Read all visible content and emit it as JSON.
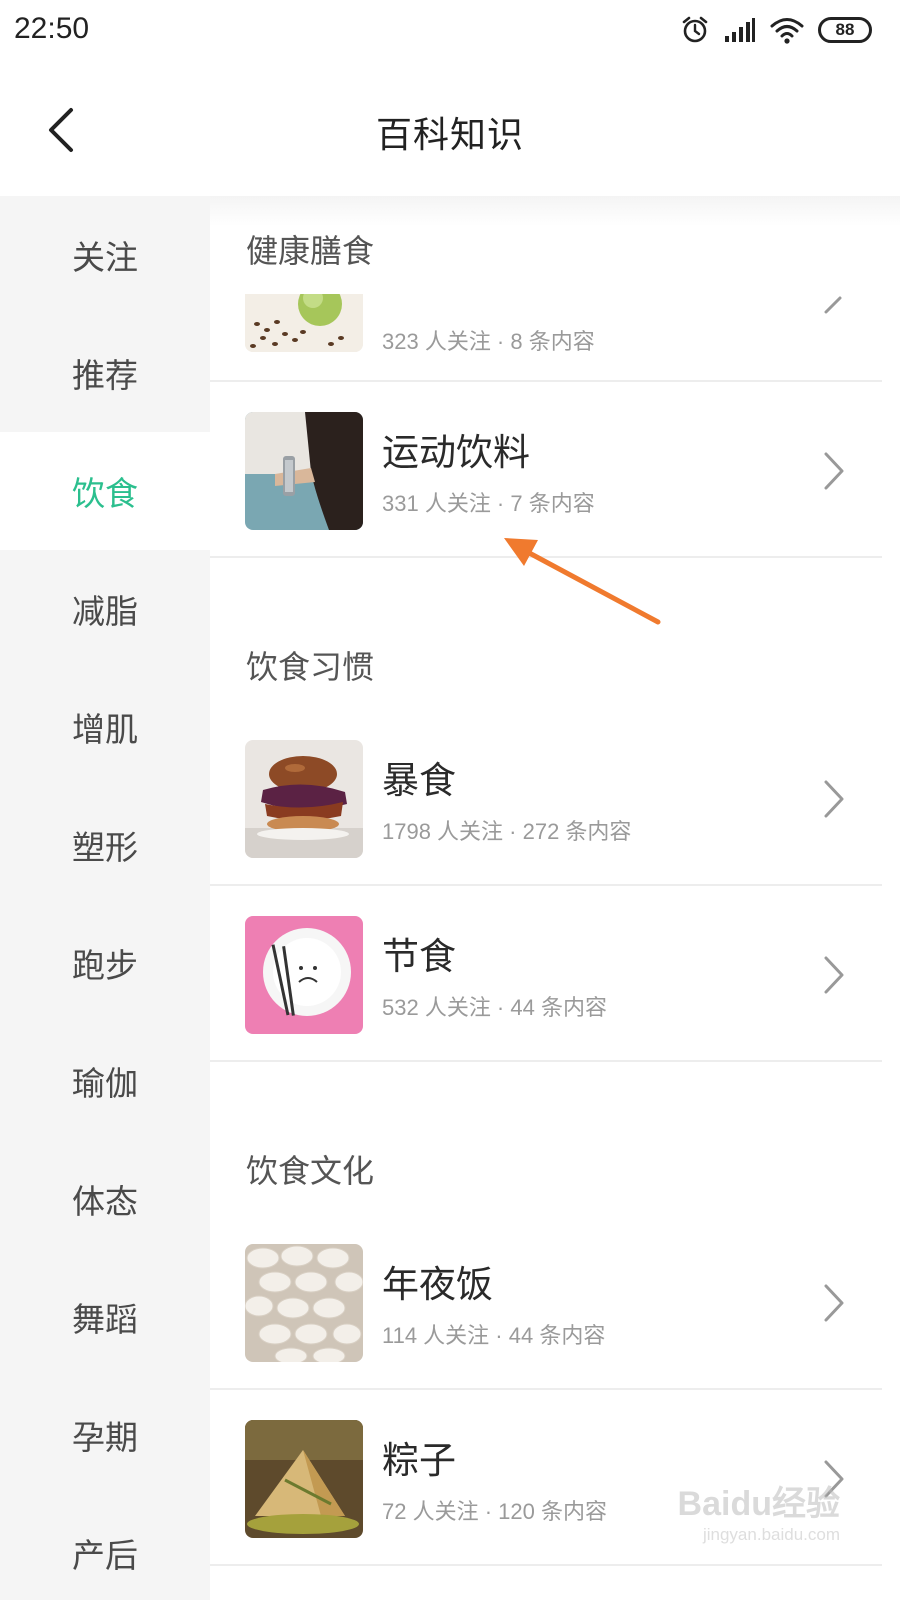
{
  "status_bar": {
    "time": "22:50",
    "battery": "88"
  },
  "header": {
    "title": "百科知识"
  },
  "sidebar": {
    "items": [
      {
        "label": "关注"
      },
      {
        "label": "推荐"
      },
      {
        "label": "饮食",
        "active": true
      },
      {
        "label": "减脂"
      },
      {
        "label": "增肌"
      },
      {
        "label": "塑形"
      },
      {
        "label": "跑步"
      },
      {
        "label": "瑜伽"
      },
      {
        "label": "体态"
      },
      {
        "label": "舞蹈"
      },
      {
        "label": "孕期"
      },
      {
        "label": "产后"
      }
    ]
  },
  "sections": [
    {
      "title": "健康膳食",
      "items": [
        {
          "name": "",
          "meta": "323 人关注 · 8 条内容"
        },
        {
          "name": "运动饮料",
          "meta": "331 人关注 · 7 条内容"
        }
      ]
    },
    {
      "title": "饮食习惯",
      "items": [
        {
          "name": "暴食",
          "meta": "1798 人关注 · 272 条内容"
        },
        {
          "name": "节食",
          "meta": "532 人关注 · 44 条内容"
        }
      ]
    },
    {
      "title": "饮食文化",
      "items": [
        {
          "name": "年夜饭",
          "meta": "114 人关注 · 44 条内容"
        },
        {
          "name": "粽子",
          "meta": "72 人关注 · 120 条内容"
        }
      ]
    }
  ],
  "annotation": {
    "color": "#f07a2e"
  },
  "colors": {
    "accent": "#2bbf8e",
    "sidebar_bg": "#f5f5f5"
  },
  "watermark": {
    "text": "Baidu经验",
    "url_text": "jingyan.baidu.com"
  }
}
